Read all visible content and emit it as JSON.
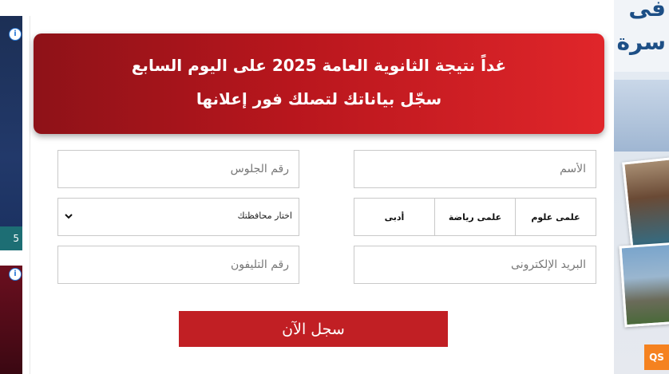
{
  "banner": {
    "line1": "غداً نتيجة الثانوية العامة 2025 على اليوم السابع",
    "line2": "سجّل بياناتك لتصلك فور إعلانها"
  },
  "form": {
    "name_placeholder": "الأسم",
    "seat_placeholder": "رقم الجلوس",
    "email_placeholder": "البريد الإلكترونى",
    "phone_placeholder": "رقم التليفون",
    "governorate_select": "اختار محافظتك",
    "divisions": [
      "علمى علوم",
      "علمى رياضة",
      "أدبى"
    ],
    "submit_label": "سجل الآن"
  },
  "ads": {
    "left_top_badge": "5",
    "right_brand_badge": "QS",
    "right_headline_1": "فى",
    "right_headline_2": "سرة"
  },
  "colors": {
    "banner_start": "#8e1218",
    "banner_end": "#e0262a",
    "submit_bg": "#c11f24"
  }
}
